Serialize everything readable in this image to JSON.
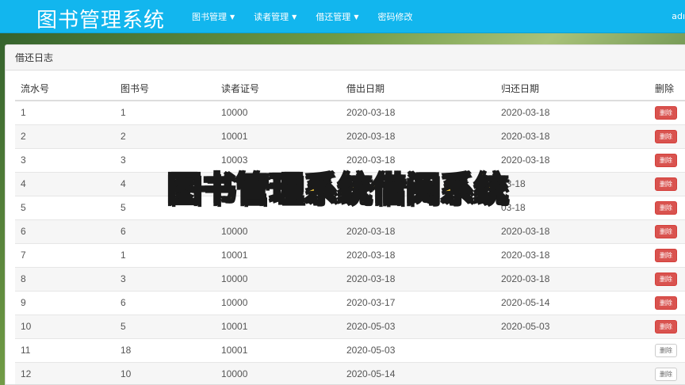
{
  "navbar": {
    "brand": "图书管理系统",
    "menu": [
      {
        "label": "图书管理"
      },
      {
        "label": "读者管理"
      },
      {
        "label": "借还管理"
      },
      {
        "label": "密码修改"
      }
    ],
    "user_abbr": "adı"
  },
  "panel": {
    "title": "借还日志",
    "columns": [
      "流水号",
      "图书号",
      "读者证号",
      "借出日期",
      "归还日期",
      "删除"
    ],
    "delete_label": "删除",
    "rows": [
      {
        "serial": "1",
        "book": "1",
        "reader": "10000",
        "out": "2020-03-18",
        "back": "2020-03-18",
        "returned": true
      },
      {
        "serial": "2",
        "book": "2",
        "reader": "10001",
        "out": "2020-03-18",
        "back": "2020-03-18",
        "returned": true
      },
      {
        "serial": "3",
        "book": "3",
        "reader": "10003",
        "out": "2020-03-18",
        "back": "2020-03-18",
        "returned": true
      },
      {
        "serial": "4",
        "book": "4",
        "reader": "",
        "out": "",
        "back": "03-18",
        "returned": true
      },
      {
        "serial": "5",
        "book": "5",
        "reader": "",
        "out": "",
        "back": "03-18",
        "returned": true
      },
      {
        "serial": "6",
        "book": "6",
        "reader": "10000",
        "out": "2020-03-18",
        "back": "2020-03-18",
        "returned": true
      },
      {
        "serial": "7",
        "book": "1",
        "reader": "10001",
        "out": "2020-03-18",
        "back": "2020-03-18",
        "returned": true
      },
      {
        "serial": "8",
        "book": "3",
        "reader": "10000",
        "out": "2020-03-18",
        "back": "2020-03-18",
        "returned": true
      },
      {
        "serial": "9",
        "book": "6",
        "reader": "10000",
        "out": "2020-03-17",
        "back": "2020-05-14",
        "returned": true
      },
      {
        "serial": "10",
        "book": "5",
        "reader": "10001",
        "out": "2020-05-03",
        "back": "2020-05-03",
        "returned": true
      },
      {
        "serial": "11",
        "book": "18",
        "reader": "10001",
        "out": "2020-05-03",
        "back": "",
        "returned": false
      },
      {
        "serial": "12",
        "book": "10",
        "reader": "10000",
        "out": "2020-05-14",
        "back": "",
        "returned": false
      }
    ]
  },
  "overlay_caption": "图书管理系统借阅系统",
  "colors": {
    "navbar": "#12b6ee",
    "delete_active": "#d9534f",
    "caption": "#ffd23a"
  }
}
